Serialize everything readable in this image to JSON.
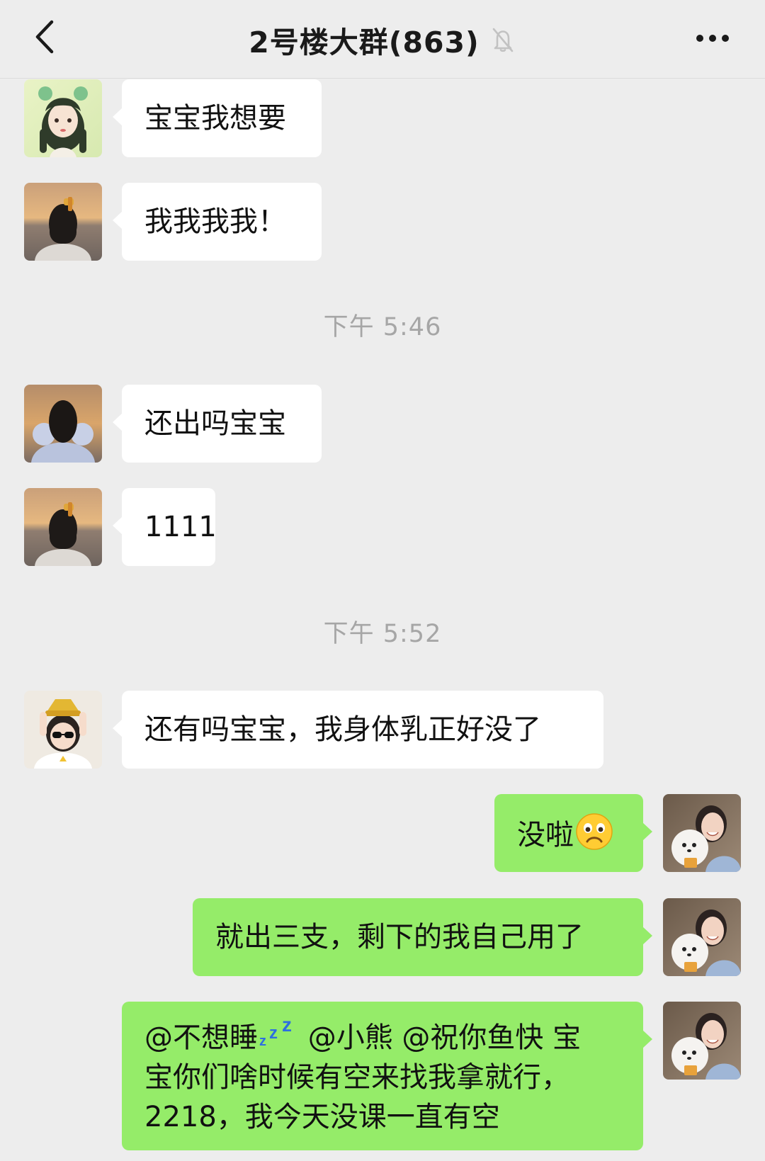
{
  "nav": {
    "title": "2号楼大群(863)",
    "back_icon": "chevron-left-icon",
    "mute_icon": "bell-off-icon",
    "more_icon": "more-dots-icon"
  },
  "messages": [
    {
      "side": "left",
      "avatar": "avatar-green-hair-girl",
      "text": "宝宝我想要"
    },
    {
      "side": "left",
      "avatar": "avatar-girl-back-view",
      "text": "我我我我！"
    },
    {
      "type": "time",
      "text": "下午 5:46"
    },
    {
      "side": "left",
      "avatar": "avatar-girl-sea-dress",
      "text": "还出吗宝宝"
    },
    {
      "side": "left",
      "avatar": "avatar-girl-back-view",
      "text": "1111"
    },
    {
      "type": "time",
      "text": "下午 5:52"
    },
    {
      "side": "left",
      "avatar": "avatar-girl-sunglasses",
      "text": "还有吗宝宝，我身体乳正好没了"
    },
    {
      "side": "right",
      "avatar": "avatar-self-dog",
      "text": "没啦",
      "emoji": "frowning-face-emoji"
    },
    {
      "side": "right",
      "avatar": "avatar-self-dog",
      "text": "就出三支，剩下的我自己用了"
    },
    {
      "side": "right",
      "avatar": "avatar-self-dog",
      "line1_part1": "@不想睡",
      "line1_emoji": "zzz-emoji",
      "line1_part2": " @小熊 @祝你鱼快 宝",
      "line2": "宝你们啥时候有空来找我拿就行，",
      "line3": "2218，我今天没课一直有空"
    }
  ],
  "colors": {
    "background": "#ededed",
    "bubble_self": "#95ec69",
    "bubble_other": "#ffffff",
    "time_text": "#a6a6a6"
  }
}
